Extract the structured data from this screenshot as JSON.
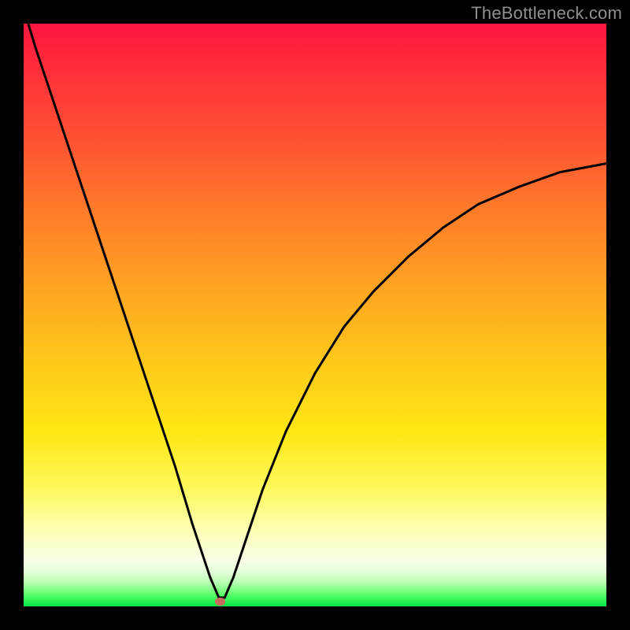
{
  "watermark": "TheBottleneck.com",
  "marker": {
    "x_norm": 0.337,
    "y_norm": 0.992
  },
  "colors": {
    "curve_stroke": "#000000",
    "marker_fill": "#c76b5e",
    "background": "#000000",
    "gradient_top": "#ff153f",
    "gradient_bottom": "#00e646"
  },
  "chart_data": {
    "type": "line",
    "title": "",
    "xlabel": "",
    "ylabel": "",
    "xlim": [
      0,
      1
    ],
    "ylim": [
      0,
      1
    ],
    "series": [
      {
        "name": "curve",
        "x": [
          0.008,
          0.02,
          0.05,
          0.08,
          0.11,
          0.14,
          0.17,
          0.2,
          0.23,
          0.26,
          0.29,
          0.3,
          0.31,
          0.32,
          0.335,
          0.345,
          0.36,
          0.38,
          0.41,
          0.45,
          0.5,
          0.55,
          0.6,
          0.66,
          0.72,
          0.78,
          0.85,
          0.92,
          1.0
        ],
        "y": [
          1.0,
          0.96,
          0.87,
          0.78,
          0.69,
          0.6,
          0.51,
          0.42,
          0.33,
          0.24,
          0.14,
          0.11,
          0.08,
          0.05,
          0.015,
          0.015,
          0.05,
          0.11,
          0.2,
          0.3,
          0.4,
          0.48,
          0.54,
          0.6,
          0.65,
          0.69,
          0.72,
          0.745,
          0.76
        ]
      }
    ],
    "marker_point": {
      "x": 0.337,
      "y": 0.008
    },
    "notes": "Bottleneck-style chart: V-shaped curve against vertical red→green gradient; minimum near x≈0.34 touching y≈0."
  }
}
